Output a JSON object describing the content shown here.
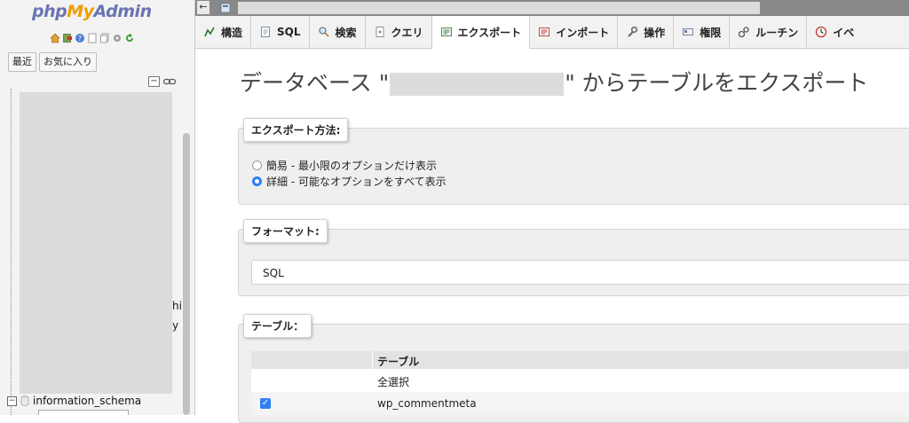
{
  "app": {
    "logo_php": "php",
    "logo_my": "My",
    "logo_admin": "Admin"
  },
  "nav": {
    "tabs": [
      "最近",
      "お気に入り"
    ],
    "collapse_label": "−",
    "tree_fragments": [
      "hi",
      "y"
    ],
    "info_schema_label": "information_schema",
    "info_schema_expander": "−"
  },
  "topbar": {
    "back_label": "←"
  },
  "tabs": [
    {
      "label": "構造",
      "icon": "structure-icon"
    },
    {
      "label": "SQL",
      "icon": "sql-icon"
    },
    {
      "label": "検索",
      "icon": "search-icon"
    },
    {
      "label": "クエリ",
      "icon": "query-icon"
    },
    {
      "label": "エクスポート",
      "icon": "export-icon",
      "active": true
    },
    {
      "label": "インポート",
      "icon": "import-icon"
    },
    {
      "label": "操作",
      "icon": "wrench-icon"
    },
    {
      "label": "権限",
      "icon": "privileges-icon"
    },
    {
      "label": "ルーチン",
      "icon": "routines-icon"
    },
    {
      "label": "イベ",
      "icon": "events-icon"
    }
  ],
  "page": {
    "title_prefix": "データベース \"",
    "title_suffix": "\" からテーブルをエクスポート"
  },
  "export_method": {
    "legend": "エクスポート方法:",
    "options": [
      {
        "label": "簡易 - 最小限のオプションだけ表示",
        "checked": false
      },
      {
        "label": "詳細 - 可能なオプションをすべて表示",
        "checked": true
      }
    ]
  },
  "format": {
    "legend": "フォーマット:",
    "selected": "SQL"
  },
  "tables": {
    "legend": "テーブル：",
    "column_header": "テーブル",
    "select_all": "全選択",
    "rows": [
      {
        "name": "wp_commentmeta",
        "checked": true,
        "check_mark": "✓"
      }
    ]
  },
  "colors": {
    "accent": "#2f7ff2",
    "logo_blue": "#6b74b4",
    "logo_orange": "#f29b00"
  }
}
